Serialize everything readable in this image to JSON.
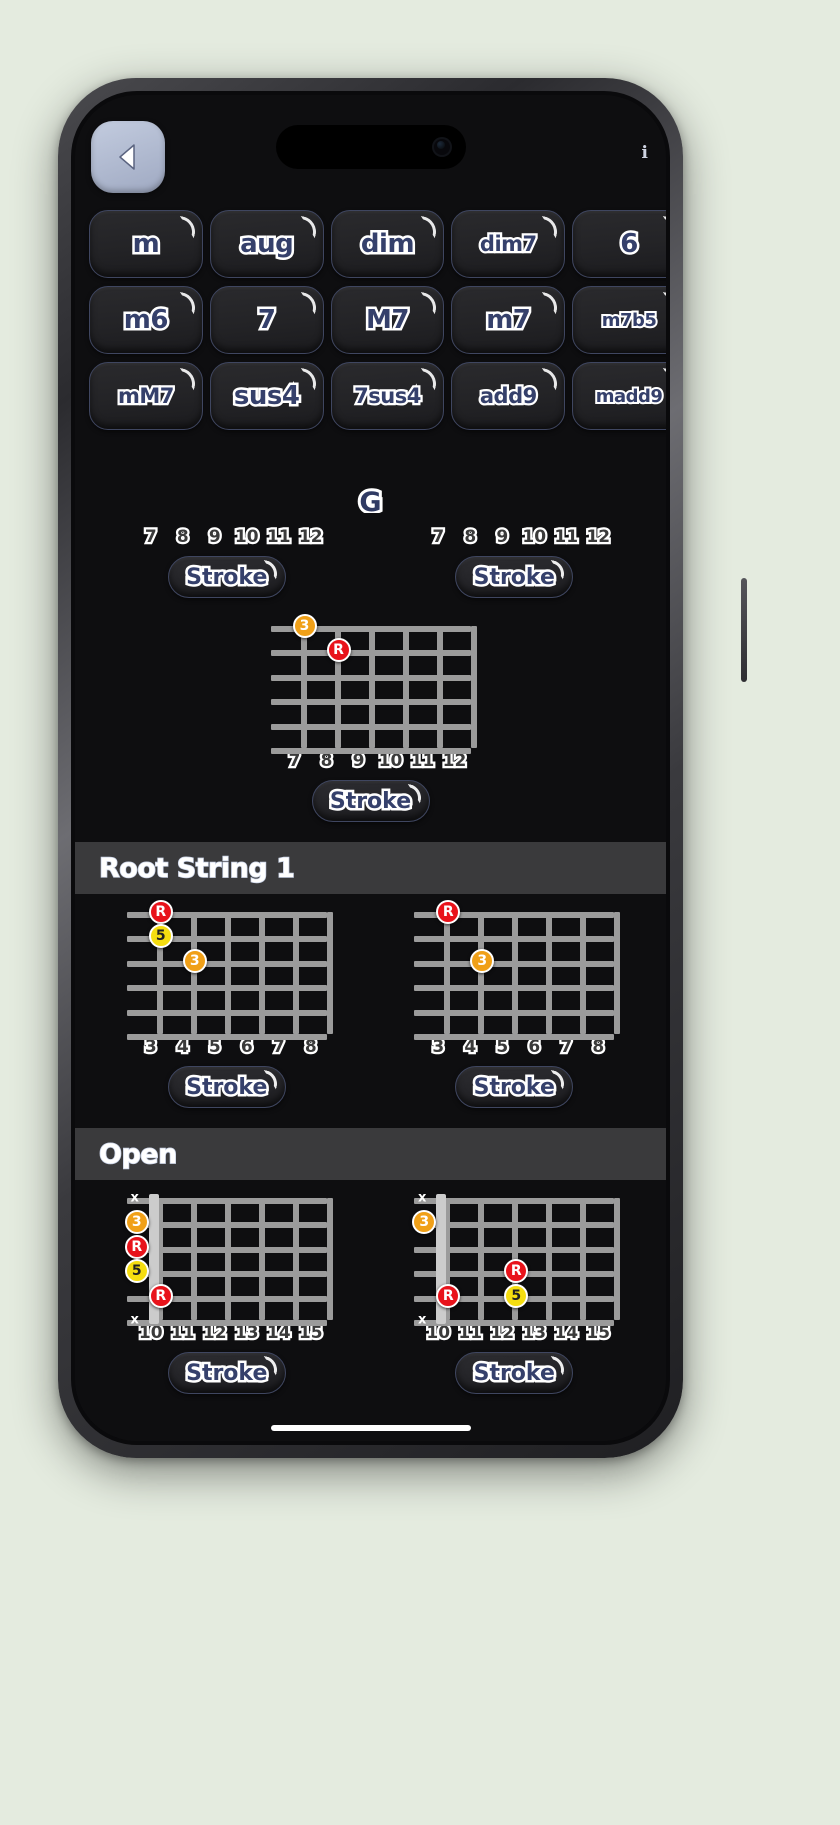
{
  "app": {
    "chord_title": "G",
    "back_icon": "back-arrow-icon",
    "info_icon": "info-icon",
    "info_glyph": "i"
  },
  "chord_types": [
    {
      "label": "m",
      "size": "lg"
    },
    {
      "label": "aug",
      "size": "lg"
    },
    {
      "label": "dim",
      "size": "lg"
    },
    {
      "label": "dim7",
      "size": "sm"
    },
    {
      "label": "6",
      "size": "lg"
    },
    {
      "label": "m6",
      "size": "lg"
    },
    {
      "label": "7",
      "size": "lg"
    },
    {
      "label": "M7",
      "size": "lg"
    },
    {
      "label": "m7",
      "size": "lg"
    },
    {
      "label": "m7b5",
      "size": "xs"
    },
    {
      "label": "mM7",
      "size": "sm"
    },
    {
      "label": "sus4",
      "size": "lg"
    },
    {
      "label": "7sus4",
      "size": "sm"
    },
    {
      "label": "add9",
      "size": "sm"
    },
    {
      "label": "madd9",
      "size": "xs"
    }
  ],
  "stroke_label": "Stroke",
  "colors": {
    "root_dot": "#e8131b",
    "third_dot": "#f0a018",
    "fifth_dot": "#f5dd10",
    "fret_line": "#9b9b9b",
    "chip_text": "#35406b",
    "header_bar": "#3a3a3c",
    "screen_bg": "#0e0e10"
  },
  "sections": [
    {
      "id": "partial-top",
      "header": null,
      "rows": [
        {
          "diagrams": [
            {
              "fret_numbers": [
                "7",
                "8",
                "9",
                "10",
                "11",
                "12"
              ],
              "numbers_on_top": true,
              "dots": [],
              "mutes": []
            },
            {
              "fret_numbers": [
                "7",
                "8",
                "9",
                "10",
                "11",
                "12"
              ],
              "numbers_on_top": true,
              "dots": [],
              "mutes": []
            }
          ]
        }
      ]
    },
    {
      "id": "single-diagram",
      "header": null,
      "rows": [
        {
          "diagrams": [
            {
              "fret_numbers": [
                "7",
                "8",
                "9",
                "10",
                "11",
                "12"
              ],
              "numbers_on_top": false,
              "dots": [
                {
                  "label": "3",
                  "kind": "third",
                  "string": 6,
                  "fret": 0
                },
                {
                  "label": "R",
                  "kind": "root",
                  "string": 5,
                  "fret": 1
                }
              ],
              "mutes": []
            }
          ]
        }
      ]
    },
    {
      "id": "root-string-1",
      "header": "Root String 1",
      "rows": [
        {
          "diagrams": [
            {
              "fret_numbers": [
                "3",
                "4",
                "5",
                "6",
                "7",
                "8"
              ],
              "numbers_on_top": false,
              "dots": [
                {
                  "label": "R",
                  "kind": "root",
                  "string": 6,
                  "fret": 0
                },
                {
                  "label": "5",
                  "kind": "fifth",
                  "string": 5,
                  "fret": 0
                },
                {
                  "label": "3",
                  "kind": "third",
                  "string": 4,
                  "fret": 1
                }
              ],
              "mutes": []
            },
            {
              "fret_numbers": [
                "3",
                "4",
                "5",
                "6",
                "7",
                "8"
              ],
              "numbers_on_top": false,
              "dots": [
                {
                  "label": "R",
                  "kind": "root",
                  "string": 6,
                  "fret": 0
                },
                {
                  "label": "3",
                  "kind": "third",
                  "string": 4,
                  "fret": 1
                }
              ],
              "mutes": []
            }
          ]
        }
      ]
    },
    {
      "id": "open",
      "header": "Open",
      "rows": [
        {
          "diagrams": [
            {
              "fret_numbers": [
                "10",
                "11",
                "12",
                "13",
                "14",
                "15"
              ],
              "numbers_on_top": false,
              "has_nut": true,
              "dots": [
                {
                  "label": "3",
                  "kind": "third",
                  "string": 5,
                  "fret": -1
                },
                {
                  "label": "R",
                  "kind": "root",
                  "string": 4,
                  "fret": -1
                },
                {
                  "label": "5",
                  "kind": "fifth",
                  "string": 3,
                  "fret": -1
                },
                {
                  "label": "R",
                  "kind": "root",
                  "string": 2,
                  "fret": 0
                }
              ],
              "mutes": [
                {
                  "string": 6
                },
                {
                  "string": 1
                }
              ]
            },
            {
              "fret_numbers": [
                "10",
                "11",
                "12",
                "13",
                "14",
                "15"
              ],
              "numbers_on_top": false,
              "has_nut": true,
              "dots": [
                {
                  "label": "3",
                  "kind": "third",
                  "string": 5,
                  "fret": -1
                },
                {
                  "label": "R",
                  "kind": "root",
                  "string": 3,
                  "fret": 2
                },
                {
                  "label": "5",
                  "kind": "fifth",
                  "string": 2,
                  "fret": 2
                },
                {
                  "label": "R",
                  "kind": "root",
                  "string": 2,
                  "fret": 0
                }
              ],
              "mutes": [
                {
                  "string": 6
                },
                {
                  "string": 1
                }
              ]
            }
          ]
        }
      ]
    }
  ]
}
